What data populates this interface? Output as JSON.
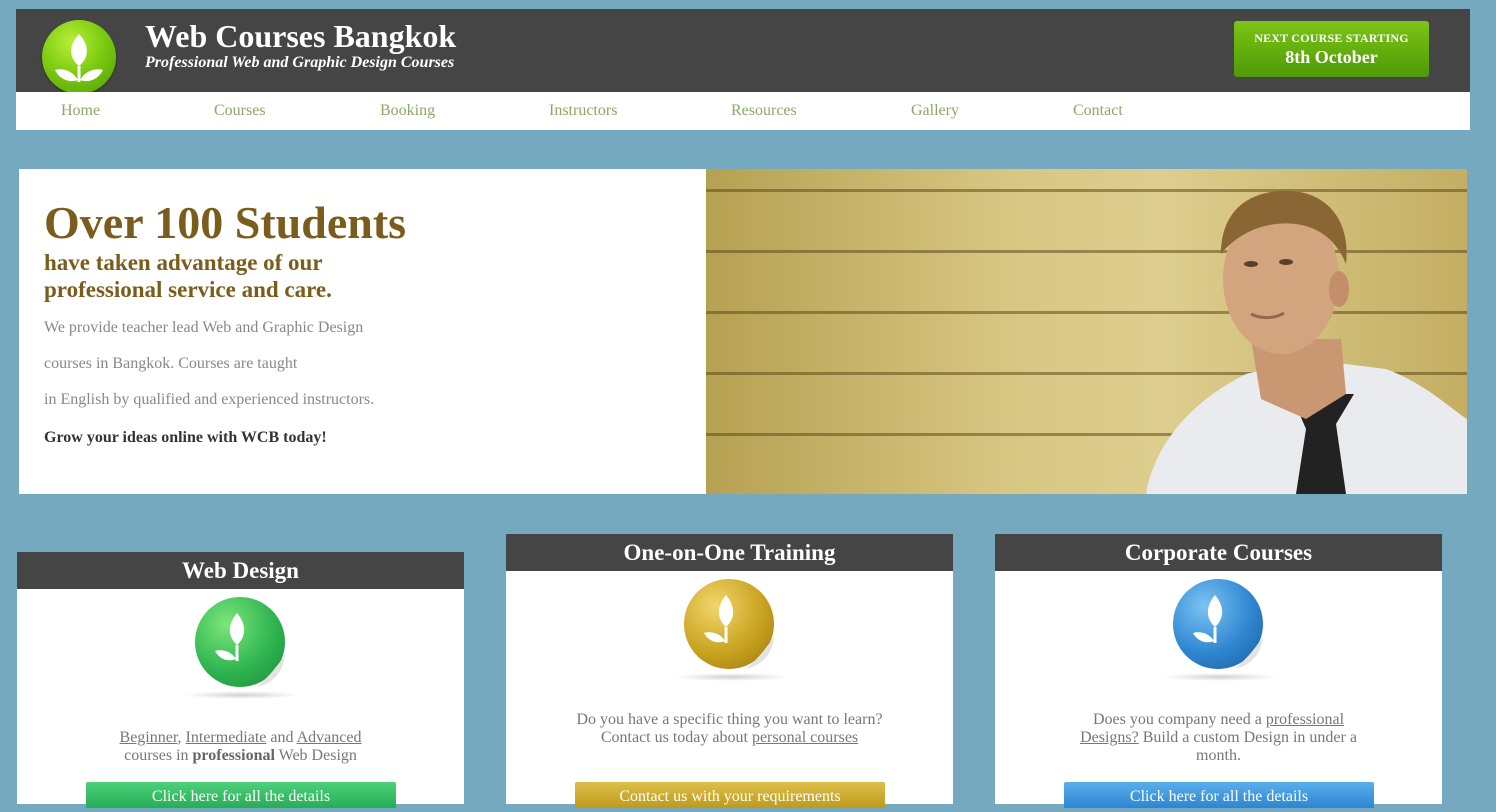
{
  "header": {
    "logo_icon": "leaf-logo-icon",
    "title": "Web Courses Bangkok",
    "tagline": "Professional Web and Graphic Design Courses",
    "next_course": {
      "label": "NEXT COURSE STARTING",
      "date": "8th October"
    }
  },
  "nav": {
    "items": [
      "Home",
      "Courses",
      "Booking",
      "Instructors",
      "Resources",
      "Gallery",
      "Contact"
    ]
  },
  "hero": {
    "headline": "Over 100 Students",
    "subheadline": "have taken advantage of our professional service and care.",
    "lines": [
      "We provide teacher lead Web and Graphic Design",
      "courses in Bangkok. Courses are taught",
      "in English by qualified and experienced instructors."
    ],
    "cta": "Grow your ideas online with WCB today!"
  },
  "cards": [
    {
      "title": "Web Design",
      "icon": "green-leaf-sticker-icon",
      "color": "#2fb551",
      "text": {
        "link1": "Beginner",
        "sep1": ", ",
        "link2": "Intermediate",
        "sep2": " and ",
        "link3": "Advanced",
        "line2a": "courses in ",
        "bold": "professional",
        "line2b": " Web Design"
      },
      "button": "Click here for all the details"
    },
    {
      "title": "One-on-One Training",
      "icon": "gold-leaf-sticker-icon",
      "color": "#c9a320",
      "text": {
        "pre": "Do you have a specific thing you want to learn? Contact us today about ",
        "link": "personal courses"
      },
      "button": "Contact us with your requirements"
    },
    {
      "title": "Corporate Courses",
      "icon": "blue-leaf-sticker-icon",
      "color": "#2f86d0",
      "text": {
        "pre": "Does you company need a ",
        "link": "professional Designs?",
        "post": " Build a custom Design in under a month."
      },
      "button": "Click here for all the details"
    }
  ]
}
